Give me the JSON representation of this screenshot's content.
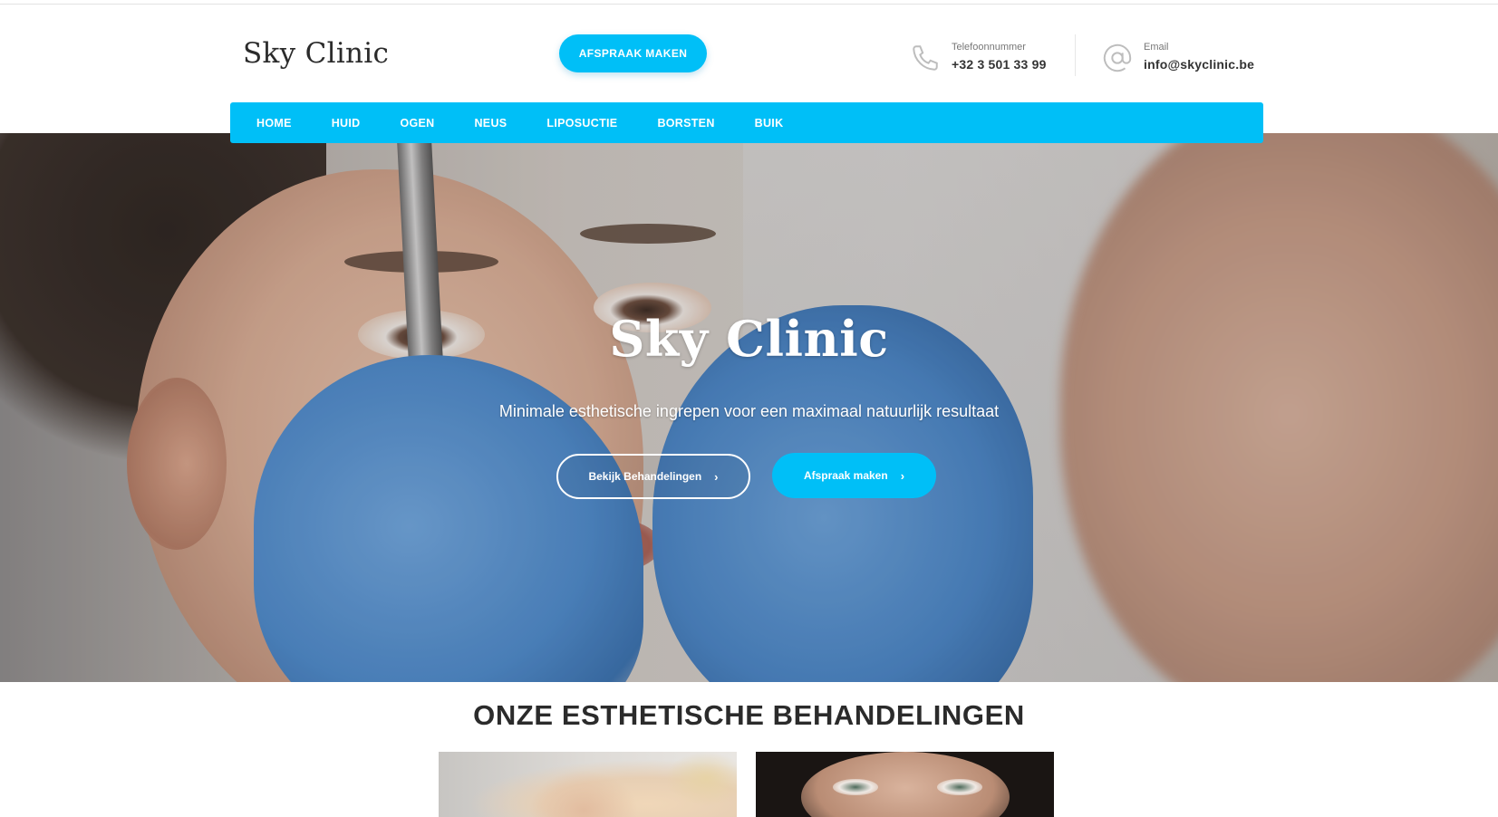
{
  "header": {
    "logo": "Sky Clinic",
    "cta_label": "AFSPRAAK MAKEN",
    "phone": {
      "label": "Telefoonnummer",
      "value": "+32 3 501 33 99",
      "icon": "phone-icon"
    },
    "email": {
      "label": "Email",
      "value": "info@skyclinic.be",
      "icon": "at-sign-icon"
    }
  },
  "nav": {
    "items": [
      {
        "label": "HOME"
      },
      {
        "label": "HUID"
      },
      {
        "label": "OGEN"
      },
      {
        "label": "NEUS"
      },
      {
        "label": "LIPOSUCTIE"
      },
      {
        "label": "BORSTEN"
      },
      {
        "label": "BUIK"
      }
    ]
  },
  "hero": {
    "title": "Sky Clinic",
    "subtitle": "Minimale esthetische ingrepen voor een maximaal natuurlijk resultaat",
    "primary_button": "Bekijk Behandelingen",
    "secondary_button": "Afspraak maken"
  },
  "section": {
    "title": "ONZE ESTHETISCHE BEHANDELINGEN"
  },
  "colors": {
    "accent": "#00bff7",
    "text_dark": "#2b2b2b"
  }
}
